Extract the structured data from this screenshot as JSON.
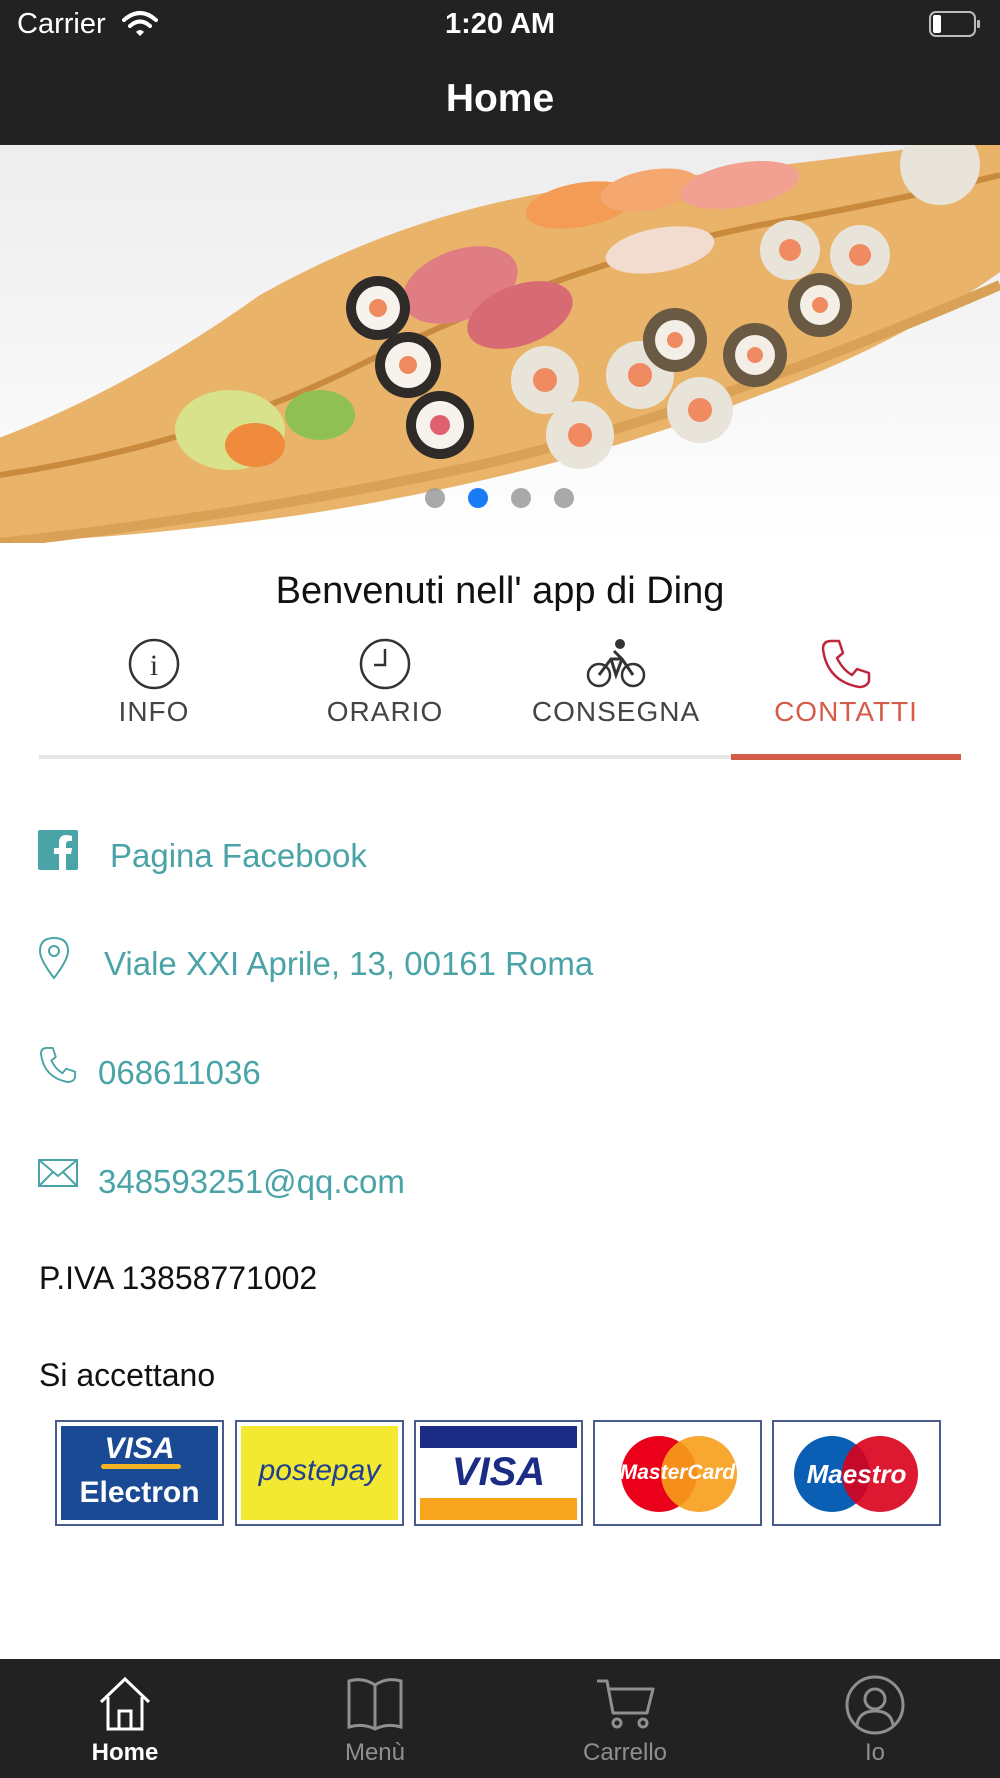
{
  "status_bar": {
    "carrier": "Carrier",
    "time": "1:20 AM"
  },
  "nav": {
    "title": "Home"
  },
  "hero": {
    "slide_count": 4,
    "active_slide": 2
  },
  "welcome": "Benvenuti nell' app di Ding",
  "tabs": [
    {
      "label": "INFO",
      "icon": "info-icon"
    },
    {
      "label": "ORARIO",
      "icon": "clock-icon"
    },
    {
      "label": "CONSEGNA",
      "icon": "bicycle-icon"
    },
    {
      "label": "CONTATTI",
      "icon": "phone-icon",
      "active": true
    }
  ],
  "contacts": {
    "facebook": "Pagina Facebook",
    "address": "Viale XXI Aprile, 13, 00161 Roma",
    "phone": "068611036",
    "email": "348593251@qq.com"
  },
  "piva": "P.IVA 13858771002",
  "payments": {
    "title": "Si accettano",
    "cards": [
      {
        "line1": "VISA",
        "line2": "Electron"
      },
      {
        "line1": "postepay"
      },
      {
        "line1": "VISA"
      },
      {
        "line1": "MasterCard"
      },
      {
        "line1": "Maestro"
      }
    ]
  },
  "tabbar": [
    {
      "label": "Home",
      "icon": "home-icon",
      "active": true
    },
    {
      "label": "Menù",
      "icon": "book-icon"
    },
    {
      "label": "Carrello",
      "icon": "cart-icon"
    },
    {
      "label": "Io",
      "icon": "user-icon"
    }
  ],
  "colors": {
    "accent": "#d65c4a",
    "link": "#4aa3a6",
    "bar": "#222222",
    "dot_active": "#1a7cf5"
  }
}
